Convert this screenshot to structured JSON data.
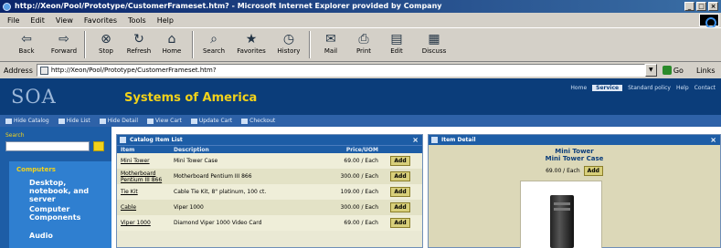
{
  "browser": {
    "title": "http://Xeon/Pool/Prototype/CustomerFrameset.htm? - Microsoft Internet Explorer provided by Company",
    "menu": [
      "File",
      "Edit",
      "View",
      "Favorites",
      "Tools",
      "Help"
    ],
    "toolbar": [
      "Back",
      "Forward",
      "Stop",
      "Refresh",
      "Home",
      "Search",
      "Favorites",
      "History",
      "Mail",
      "Print",
      "Edit",
      "Discuss"
    ],
    "address_label": "Address",
    "address": "http://Xeon/Pool/Prototype/CustomerFrameset.htm?",
    "go_label": "Go",
    "links_label": "Links"
  },
  "site": {
    "logo": "SOA",
    "name": "Systems of America",
    "nav": [
      "Home",
      "Service",
      "Standard policy",
      "Help",
      "Contact"
    ],
    "nav_active": 1,
    "toolbar": [
      "Hide Catalog",
      "Hide List",
      "Hide Detail",
      "View Cart",
      "Update Cart",
      "Checkout"
    ]
  },
  "leftnav": {
    "search_label": "Search",
    "category_header": "Computers",
    "categories": [
      "Desktop, notebook, and server",
      "Computer Components",
      "Audio"
    ]
  },
  "catalog": {
    "title": "Catalog Item List",
    "headers": [
      "Item",
      "Description",
      "Price/UOM"
    ],
    "add_label": "Add",
    "rows": [
      {
        "item": "Mini Tower",
        "description": "Mini Tower Case",
        "price": "69.00 / Each"
      },
      {
        "item": "Motherboard Pentium III 866",
        "description": "Motherboard Pentium III 866",
        "price": "300.00 / Each"
      },
      {
        "item": "Tie Kit",
        "description": "Cable Tie Kit, 8\" platinum, 100 ct.",
        "price": "109.00 / Each"
      },
      {
        "item": "Cable",
        "description": "Viper 1000",
        "price": "300.00 / Each"
      },
      {
        "item": "Viper 1000",
        "description": "Diamond Viper 1000 Video Card",
        "price": "69.00 / Each"
      }
    ]
  },
  "detail": {
    "title": "Item Detail",
    "name_line1": "Mini Tower",
    "name_line2": "Mini Tower Case",
    "price": "69.00 / Each",
    "add_label": "Add"
  }
}
